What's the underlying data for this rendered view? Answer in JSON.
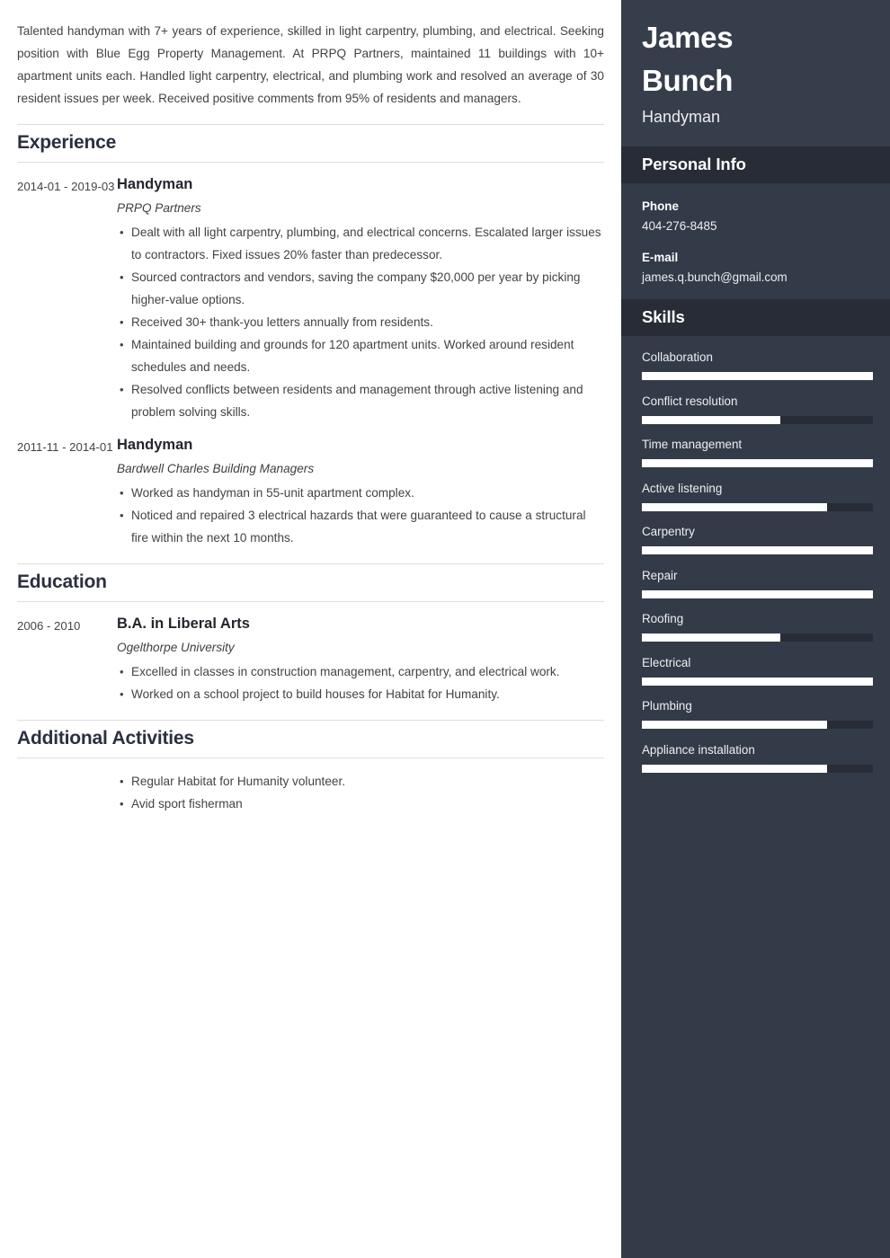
{
  "summary": "Talented handyman with 7+ years of experience, skilled in light carpentry, plumbing, and electrical. Seeking position with Blue Egg Property Management. At PRPQ Partners, maintained 11 buildings with 10+ apartment units each. Handled light carpentry, electrical, and plumbing work and resolved an average of 30 resident issues per week. Received positive comments from 95% of residents and managers.",
  "sections": {
    "experience": {
      "title": "Experience",
      "entries": [
        {
          "dates": "2014-01 - 2019-03",
          "title": "Handyman",
          "organization": "PRPQ Partners",
          "bullets": [
            "Dealt with all light carpentry, plumbing, and electrical concerns. Escalated larger issues to contractors. Fixed issues 20% faster than predecessor.",
            "Sourced contractors and vendors, saving the company $20,000 per year by picking higher-value options.",
            "Received 30+ thank-you letters annually from residents.",
            "Maintained building and grounds for 120 apartment units. Worked around resident schedules and needs.",
            "Resolved conflicts between residents and management through active listening and problem solving skills."
          ]
        },
        {
          "dates": "2011-11 - 2014-01",
          "title": "Handyman",
          "organization": "Bardwell Charles Building Managers",
          "bullets": [
            "Worked as handyman in 55-unit apartment complex.",
            "Noticed and repaired 3 electrical hazards that were guaranteed to cause a structural fire within the next 10 months."
          ]
        }
      ]
    },
    "education": {
      "title": "Education",
      "entries": [
        {
          "dates": "2006 - 2010",
          "title": "B.A. in Liberal Arts",
          "organization": "Ogelthorpe University",
          "bullets": [
            "Excelled in classes in construction management, carpentry, and electrical work.",
            "Worked on a school project to build houses for Habitat for Humanity."
          ]
        }
      ]
    },
    "additional_activities": {
      "title": "Additional Activities",
      "bullets": [
        "Regular Habitat for Humanity volunteer.",
        "Avid sport fisherman"
      ]
    }
  },
  "sidebar": {
    "first_name": "James",
    "last_name": "Bunch",
    "job_title": "Handyman",
    "personal_info": {
      "title": "Personal Info",
      "items": [
        {
          "label": "Phone",
          "value": "404-276-8485"
        },
        {
          "label": "E-mail",
          "value": "james.q.bunch@gmail.com"
        }
      ]
    },
    "skills": {
      "title": "Skills",
      "items": [
        {
          "name": "Collaboration",
          "level": 100
        },
        {
          "name": "Conflict resolution",
          "level": 60
        },
        {
          "name": "Time management",
          "level": 100
        },
        {
          "name": "Active listening",
          "level": 80
        },
        {
          "name": "Carpentry",
          "level": 100
        },
        {
          "name": "Repair",
          "level": 100
        },
        {
          "name": "Roofing",
          "level": 60
        },
        {
          "name": "Electrical",
          "level": 100
        },
        {
          "name": "Plumbing",
          "level": 80
        },
        {
          "name": "Appliance installation",
          "level": 80
        }
      ]
    }
  },
  "colors": {
    "sidebar_bg": "#343b48",
    "sidebar_name_bg": "#373e4b",
    "sidebar_band_bg": "#272c36",
    "skill_fill": "#ffffff",
    "heading_text": "#2b3040",
    "body_text": "#434343",
    "rule": "#dedede"
  }
}
